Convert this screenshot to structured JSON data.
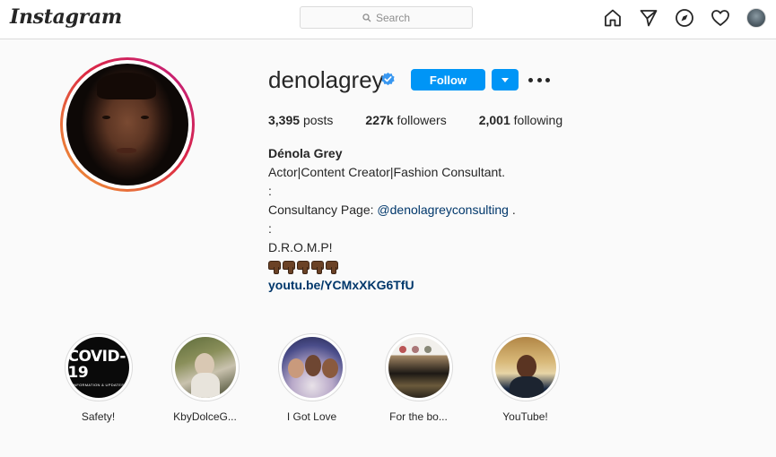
{
  "nav": {
    "logo": "Instagram",
    "search_placeholder": "Search",
    "icons": [
      "home-icon",
      "direct-icon",
      "explore-icon",
      "activity-heart-icon",
      "profile-avatar"
    ]
  },
  "profile": {
    "username": "denolagrey",
    "verified": true,
    "follow_label": "Follow",
    "stats": {
      "posts_count": "3,395",
      "posts_label": "posts",
      "followers_count": "227k",
      "followers_label": "followers",
      "following_count": "2,001",
      "following_label": "following"
    },
    "bio": {
      "name": "Dénola Grey",
      "line1": "Actor|Content Creator|Fashion Consultant.",
      "line2": ":",
      "line3_prefix": "Consultancy Page: ",
      "line3_mention": "@denolagreyconsulting",
      "line3_suffix": " .",
      "line4": ":",
      "line5": "D.R.O.M.P!",
      "emoji": "👇🏾👇🏾👇🏾👇🏾👇🏾",
      "link": "youtu.be/YCMxXKG6TfU"
    }
  },
  "highlights": [
    {
      "label": "Safety!",
      "cover_text": "COVID-19",
      "cover_subtext": "INFORMATION & UPDATES"
    },
    {
      "label": "KbyDolceG..."
    },
    {
      "label": "I Got Love"
    },
    {
      "label": "For the bo..."
    },
    {
      "label": "YouTube!"
    }
  ],
  "colors": {
    "primary_blue": "#0095f6",
    "link_blue": "#00376b",
    "verified_blue": "#3897f0",
    "text": "#262626",
    "background": "#fafafa"
  }
}
